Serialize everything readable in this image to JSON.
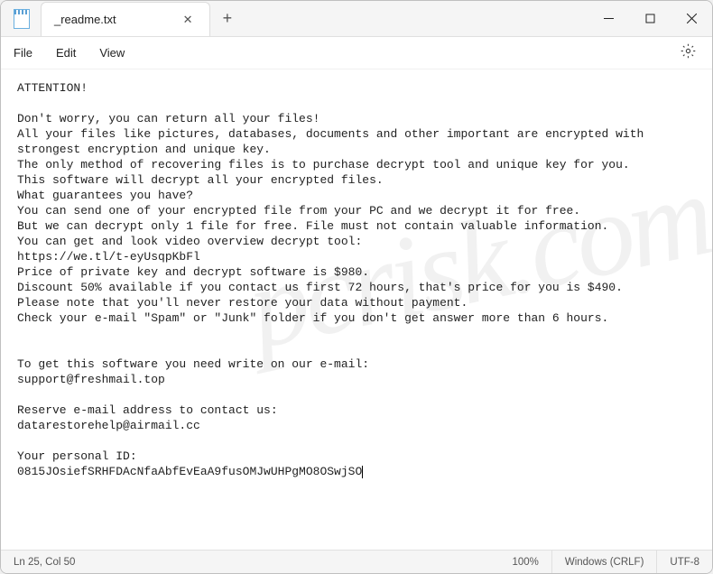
{
  "tab": {
    "title": "_readme.txt"
  },
  "menu": {
    "file": "File",
    "edit": "Edit",
    "view": "View"
  },
  "body": {
    "l1": "ATTENTION!",
    "l2": "",
    "l3": "Don't worry, you can return all your files!",
    "l4": "All your files like pictures, databases, documents and other important are encrypted with strongest encryption and unique key.",
    "l5": "The only method of recovering files is to purchase decrypt tool and unique key for you.",
    "l6": "This software will decrypt all your encrypted files.",
    "l7": "What guarantees you have?",
    "l8": "You can send one of your encrypted file from your PC and we decrypt it for free.",
    "l9": "But we can decrypt only 1 file for free. File must not contain valuable information.",
    "l10": "You can get and look video overview decrypt tool:",
    "l11": "https://we.tl/t-eyUsqpKbFl",
    "l12": "Price of private key and decrypt software is $980.",
    "l13": "Discount 50% available if you contact us first 72 hours, that's price for you is $490.",
    "l14": "Please note that you'll never restore your data without payment.",
    "l15": "Check your e-mail \"Spam\" or \"Junk\" folder if you don't get answer more than 6 hours.",
    "l16": "",
    "l17": "",
    "l18": "To get this software you need write on our e-mail:",
    "l19": "support@freshmail.top",
    "l20": "",
    "l21": "Reserve e-mail address to contact us:",
    "l22": "datarestorehelp@airmail.cc",
    "l23": "",
    "l24": "Your personal ID:",
    "l25": "0815JOsiefSRHFDAcNfaAbfEvEaA9fusOMJwUHPgMO8OSwjSO"
  },
  "status": {
    "position": "Ln 25, Col 50",
    "zoom": "100%",
    "lineend": "Windows (CRLF)",
    "encoding": "UTF-8"
  }
}
